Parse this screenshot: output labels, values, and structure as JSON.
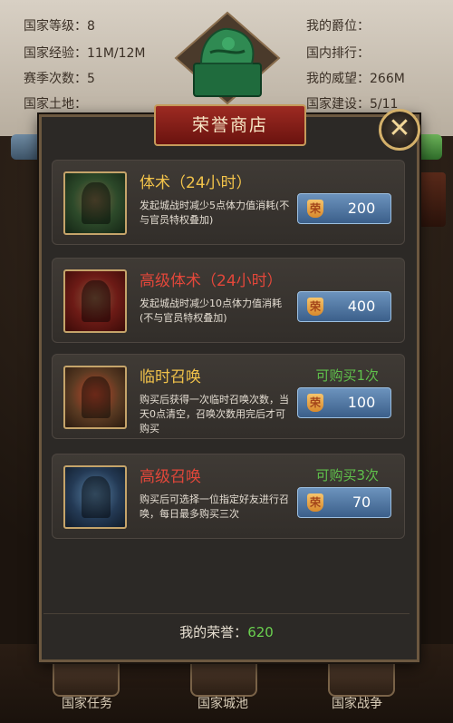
{
  "background": {
    "stats": [
      {
        "label": "国家等级：8"
      },
      {
        "label": "国家经验：11M/12M"
      },
      {
        "label": "赛季次数：5"
      },
      {
        "label": "国家土地："
      },
      {
        "label": "我的爵位："
      },
      {
        "label": "国内排行："
      },
      {
        "label": "我的威望：266M"
      },
      {
        "label": "国家建设：5/11"
      }
    ],
    "bottom_nav": [
      "国家任务",
      "国家城池",
      "国家战争"
    ]
  },
  "dialog": {
    "title": "荣誉商店",
    "close_glyph": "✕",
    "items": [
      {
        "name": "体术（24小时）",
        "name_color": "#f2c34a",
        "desc": "发起城战时减少5点体力值消耗(不与官员特权叠加)",
        "limit": "",
        "price": "200",
        "icon": "green-warrior-icon"
      },
      {
        "name": "高级体术（24小时）",
        "name_color": "#e2473a",
        "desc": "发起城战时减少10点体力值消耗(不与官员特权叠加)",
        "limit": "",
        "price": "400",
        "icon": "red-warrior-icon"
      },
      {
        "name": "临时召唤",
        "name_color": "#f2c34a",
        "desc": "购买后获得一次临时召唤次数，当天0点清空，召唤次数用完后才可购买",
        "limit": "可购买1次",
        "price": "100",
        "icon": "banner-icon"
      },
      {
        "name": "高级召唤",
        "name_color": "#e2473a",
        "desc": "购买后可选择一位指定好友进行召唤，每日最多购买三次",
        "limit": "可购买3次",
        "price": "70",
        "icon": "blue-banner-icon"
      }
    ],
    "footer_label": "我的荣誉：",
    "footer_value": "620"
  }
}
